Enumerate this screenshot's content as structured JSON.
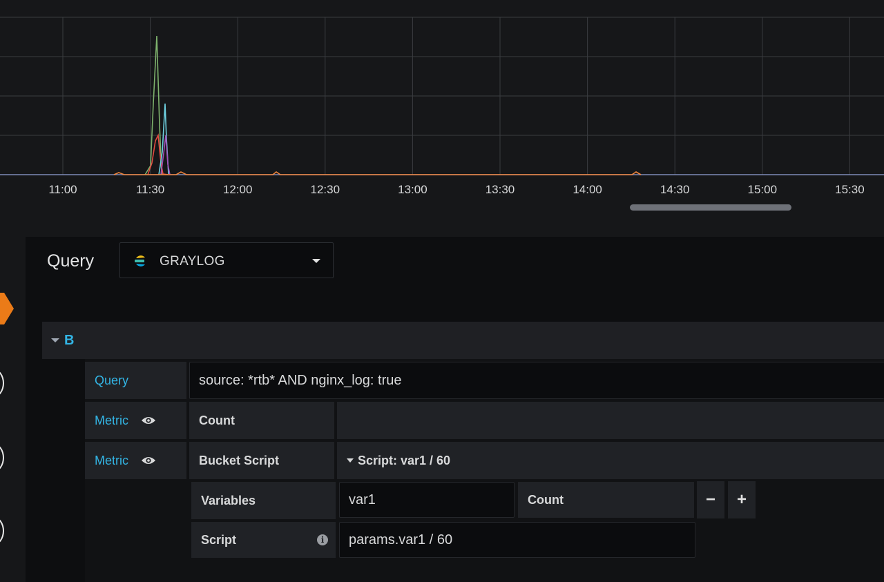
{
  "graph": {
    "x_ticks": [
      "11:00",
      "11:30",
      "12:00",
      "12:30",
      "13:00",
      "13:30",
      "14:00",
      "14:30",
      "15:00",
      "15:30"
    ],
    "colors": {
      "background": "#161719",
      "grid": "#3a3c40",
      "baseline": "#7f8bb8",
      "series_green": "#7eb26d",
      "series_red": "#e24d42",
      "series_cyan": "#6ed0e0",
      "series_purple": "#a14fb9",
      "series_orange": "#ef843c"
    }
  },
  "editor": {
    "heading": "Query",
    "datasource": {
      "name": "GRAYLOG",
      "logo_icon": "elasticsearch-logo-icon"
    },
    "query_row": {
      "ref_id": "B",
      "query_label": "Query",
      "query_value": "source: *rtb* AND nginx_log: true",
      "metrics": [
        {
          "label": "Metric",
          "type": "Count",
          "setting": "",
          "visibility_icon": "eye-icon"
        },
        {
          "label": "Metric",
          "type": "Bucket Script",
          "setting": "Script: var1 / 60",
          "visibility_icon": "eye-icon"
        }
      ],
      "bucket_script": {
        "variables_label": "Variables",
        "variable_name": "var1",
        "variable_metric": "Count",
        "remove_label": "−",
        "add_label": "+",
        "script_label": "Script",
        "script_value": "params.var1 / 60",
        "info_icon": "info-icon"
      }
    }
  }
}
